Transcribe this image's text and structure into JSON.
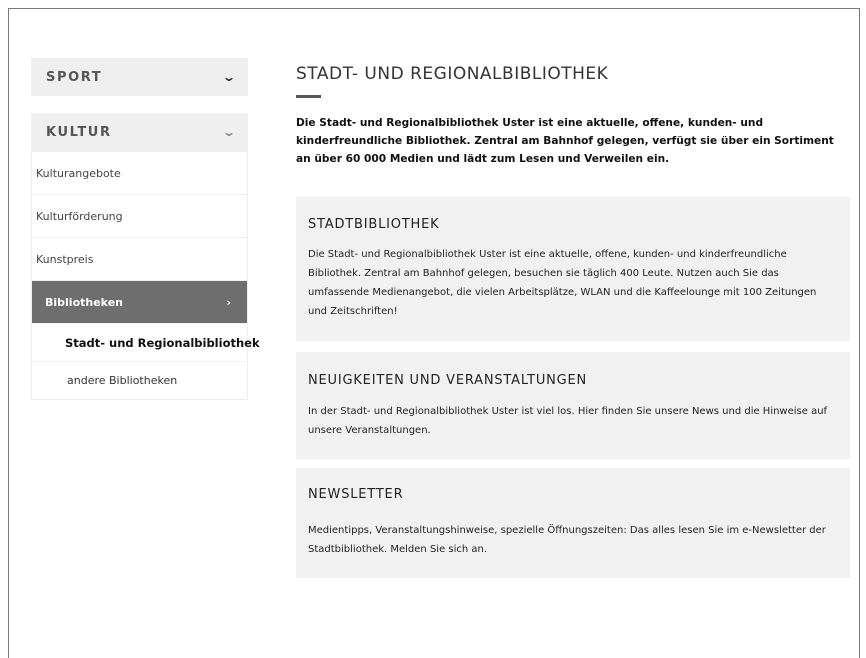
{
  "sidebar": {
    "sport": {
      "label": "SPORT",
      "icon": "chevron-down-icon"
    },
    "kultur": {
      "label": "KULTUR",
      "icon": "chevron-down-icon"
    },
    "items": [
      {
        "label": "Kulturangebote"
      },
      {
        "label": "Kulturförderung"
      },
      {
        "label": "Kunstpreis"
      },
      {
        "label": "Bibliotheken",
        "active": true,
        "icon": "chevron-right-icon"
      }
    ],
    "subitems": [
      {
        "label": "Stadt- und Regionalbibliothek",
        "current": true
      },
      {
        "label": "andere Bibliotheken"
      }
    ]
  },
  "main": {
    "title": "STADT- UND REGIONALBIBLIOTHEK",
    "intro": "Die Stadt- und Regionalbibliothek Uster ist eine aktuelle, offene, kunden- und kinderfreundliche Bibliothek. Zentral am Bahnhof gelegen, verfügt sie über ein Sortiment an über 60 000 Medien und lädt zum Lesen und Verweilen ein.",
    "cards": [
      {
        "title": "STADTBIBLIOTHEK",
        "text": "Die Stadt- und Regionalbibliothek Uster ist eine aktuelle, offene, kunden- und kinderfreundliche Bibliothek. Zentral am Bahnhof gelegen, besuchen sie täglich 400 Leute. Nutzen auch Sie das umfassende Medienangebot, die vielen Arbeitsplätze, WLAN und die Kaffeelounge mit 100 Zeitungen und Zeitschriften!"
      },
      {
        "title": "NEUIGKEITEN UND VERANSTALTUNGEN",
        "text": "In der Stadt- und Regionalbibliothek Uster ist viel los. Hier finden Sie unsere News und die Hinweise auf unsere Veranstaltungen."
      },
      {
        "title": "NEWSLETTER",
        "text": "Medientipps, Veranstaltungshinweise, spezielle Öffnungszeiten: Das alles lesen Sie im e-Newsletter der Stadtbibliothek. Melden Sie sich an."
      }
    ]
  },
  "colors": {
    "active_bg": "#6e6e6e",
    "card_bg": "#f1f1f1",
    "header_bg": "#efefef"
  }
}
